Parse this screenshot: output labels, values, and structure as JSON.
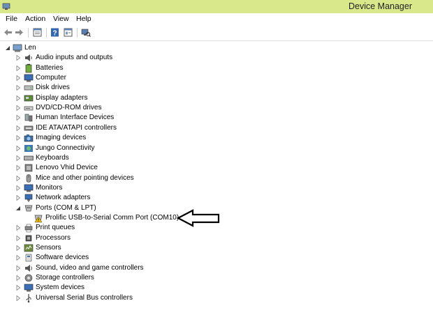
{
  "window": {
    "title": "Device Manager"
  },
  "menu": {
    "file": "File",
    "action": "Action",
    "view": "View",
    "help": "Help"
  },
  "toolbar": {
    "icons": [
      "back-arrow-icon",
      "forward-arrow-icon",
      "properties-icon",
      "help-icon",
      "device-properties-icon",
      "scan-hardware-icon"
    ]
  },
  "tree": {
    "root": "Len",
    "items": [
      {
        "label": "Audio inputs and outputs",
        "icon": "speaker-icon"
      },
      {
        "label": "Batteries",
        "icon": "battery-icon"
      },
      {
        "label": "Computer",
        "icon": "monitor-icon"
      },
      {
        "label": "Disk drives",
        "icon": "disk-icon"
      },
      {
        "label": "Display adapters",
        "icon": "display-adapter-icon"
      },
      {
        "label": "DVD/CD-ROM drives",
        "icon": "dvd-icon"
      },
      {
        "label": "Human Interface Devices",
        "icon": "hid-icon"
      },
      {
        "label": "IDE ATA/ATAPI controllers",
        "icon": "ide-icon"
      },
      {
        "label": "Imaging devices",
        "icon": "camera-icon"
      },
      {
        "label": "Jungo Connectivity",
        "icon": "jungo-icon"
      },
      {
        "label": "Keyboards",
        "icon": "keyboard-icon"
      },
      {
        "label": "Lenovo Vhid Device",
        "icon": "device-icon"
      },
      {
        "label": "Mice and other pointing devices",
        "icon": "mouse-icon"
      },
      {
        "label": "Monitors",
        "icon": "monitor-icon"
      },
      {
        "label": "Network adapters",
        "icon": "network-icon"
      },
      {
        "label": "Ports (COM & LPT)",
        "icon": "port-icon",
        "expanded": true,
        "children": [
          {
            "label": "Prolific USB-to-Serial Comm Port (COM10)",
            "icon": "warning-device-icon"
          }
        ]
      },
      {
        "label": "Print queues",
        "icon": "printer-icon"
      },
      {
        "label": "Processors",
        "icon": "processor-icon"
      },
      {
        "label": "Sensors",
        "icon": "sensor-icon"
      },
      {
        "label": "Software devices",
        "icon": "software-icon"
      },
      {
        "label": "Sound, video and game controllers",
        "icon": "sound-icon"
      },
      {
        "label": "Storage controllers",
        "icon": "storage-icon"
      },
      {
        "label": "System devices",
        "icon": "system-icon"
      },
      {
        "label": "Universal Serial Bus controllers",
        "icon": "usb-icon"
      }
    ]
  },
  "colors": {
    "titlebar": "#d9e88a",
    "accent": "#4a7fc1",
    "warning": "#e8c500"
  }
}
